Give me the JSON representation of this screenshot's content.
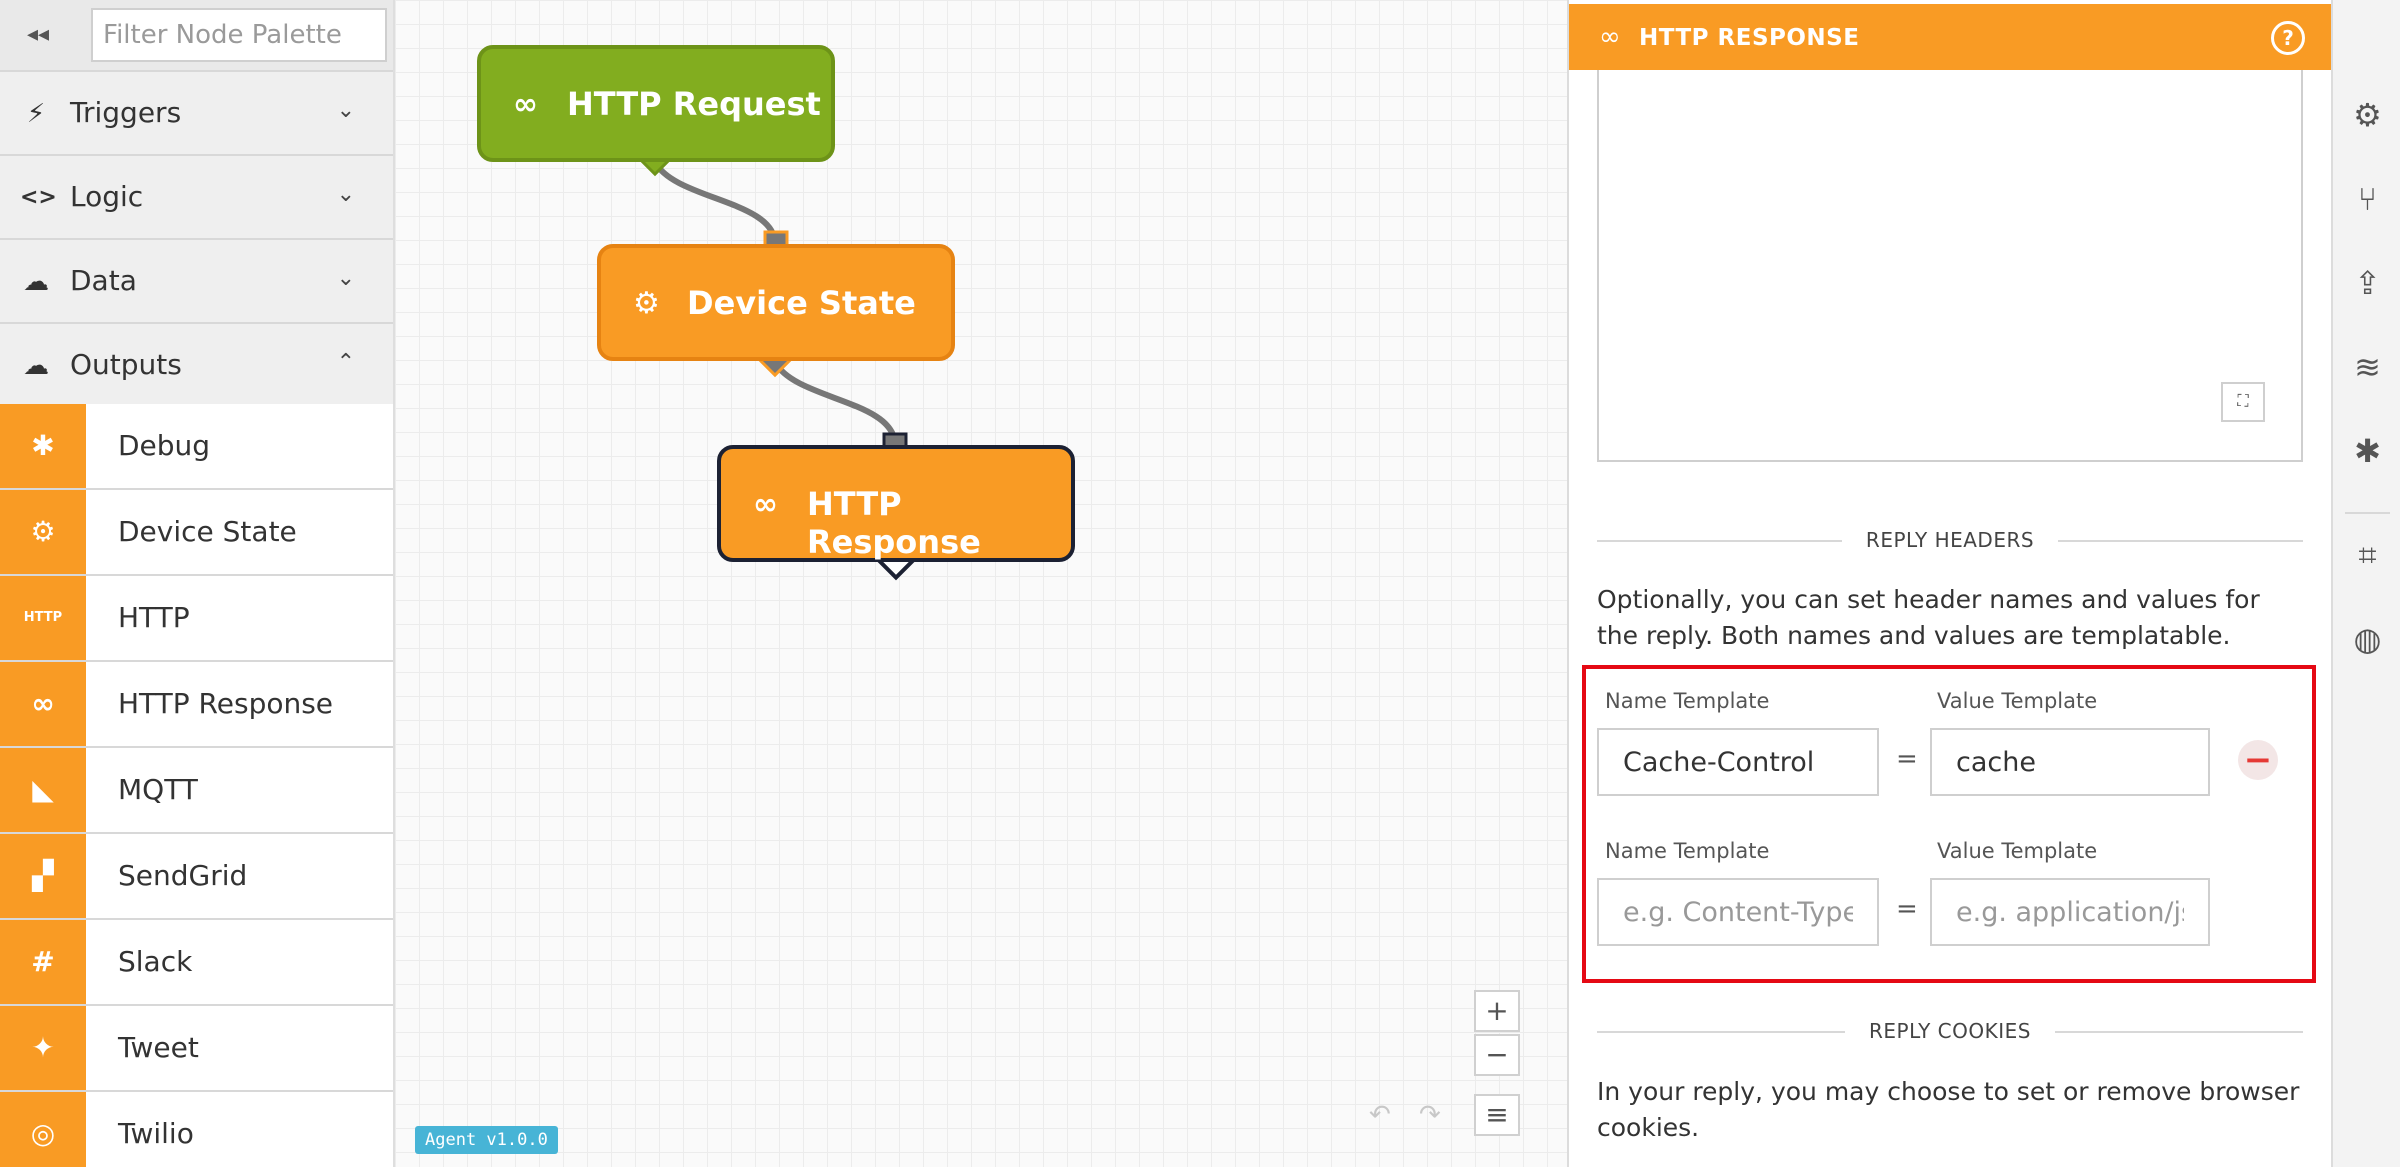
{
  "palette": {
    "collapse_glyph": "◂◂",
    "filter_placeholder": "Filter Node Palette",
    "categories": [
      {
        "label": "Triggers",
        "icon": "bolt-icon",
        "glyph": "⚡",
        "chevron": "⌄"
      },
      {
        "label": "Logic",
        "icon": "code-icon",
        "glyph": "<>",
        "chevron": "⌄"
      },
      {
        "label": "Data",
        "icon": "cloud-download-icon",
        "glyph": "☁",
        "chevron": "⌄"
      },
      {
        "label": "Outputs",
        "icon": "cloud-upload-icon",
        "glyph": "☁",
        "chevron": "⌃"
      }
    ],
    "outputs": [
      {
        "label": "Debug",
        "icon": "bug-icon",
        "glyph": "✱"
      },
      {
        "label": "Device State",
        "icon": "chip-icon",
        "glyph": "⚙"
      },
      {
        "label": "HTTP",
        "icon": "http-icon",
        "glyph": "HTTP"
      },
      {
        "label": "HTTP Response",
        "icon": "link-icon",
        "glyph": "∞"
      },
      {
        "label": "MQTT",
        "icon": "mqtt-icon",
        "glyph": "◣"
      },
      {
        "label": "SendGrid",
        "icon": "sendgrid-icon",
        "glyph": "▞"
      },
      {
        "label": "Slack",
        "icon": "slack-icon",
        "glyph": "#"
      },
      {
        "label": "Tweet",
        "icon": "twitter-icon",
        "glyph": "✦"
      },
      {
        "label": "Twilio",
        "icon": "twilio-icon",
        "glyph": "◎"
      }
    ]
  },
  "canvas": {
    "nodes": [
      {
        "label": "HTTP Request",
        "icon": "link-icon",
        "glyph": "∞"
      },
      {
        "label": "Device State",
        "icon": "chip-icon",
        "glyph": "⚙"
      },
      {
        "label": "HTTP Response",
        "icon": "link-icon",
        "glyph": "∞"
      }
    ],
    "zoom_in": "+",
    "zoom_out": "−",
    "menu": "≡",
    "undo": "↶",
    "redo": "↷",
    "agent_version": "Agent v1.0.0"
  },
  "panel": {
    "title": "HTTP RESPONSE",
    "title_icon": "∞",
    "help_glyph": "?",
    "expand_glyph": "⛶",
    "reply_headers_title": "REPLY HEADERS",
    "reply_headers_desc": "Optionally, you can set header names and values for the reply. Both names and values are templatable.",
    "header_rows": [
      {
        "name_label": "Name Template",
        "value_label": "Value Template",
        "name_value": "Cache-Control",
        "value_value": "cache",
        "name_placeholder": "",
        "value_placeholder": ""
      },
      {
        "name_label": "Name Template",
        "value_label": "Value Template",
        "name_value": "",
        "value_value": "",
        "name_placeholder": "e.g. Content-Type",
        "value_placeholder": "e.g. application/js"
      }
    ],
    "equals": "=",
    "remove_glyph": "−",
    "reply_cookies_title": "REPLY COOKIES",
    "reply_cookies_desc": "In your reply, you may choose to set or remove browser cookies."
  },
  "toolbar": {
    "items": [
      {
        "icon": "gear-icon",
        "glyph": "⚙"
      },
      {
        "icon": "branch-icon",
        "glyph": "⑂"
      },
      {
        "icon": "upload-icon",
        "glyph": "⇪"
      },
      {
        "icon": "database-icon",
        "glyph": "≋"
      },
      {
        "icon": "debug-icon",
        "glyph": "✱"
      },
      {
        "icon": "code-bracket-icon",
        "glyph": "⌗"
      },
      {
        "icon": "globe-icon",
        "glyph": "◍"
      }
    ]
  },
  "colors": {
    "accent_orange": "#f99b24",
    "trigger_green": "#82ad1f",
    "highlight_red": "#e50914",
    "agent_blue": "#47b4d6"
  }
}
